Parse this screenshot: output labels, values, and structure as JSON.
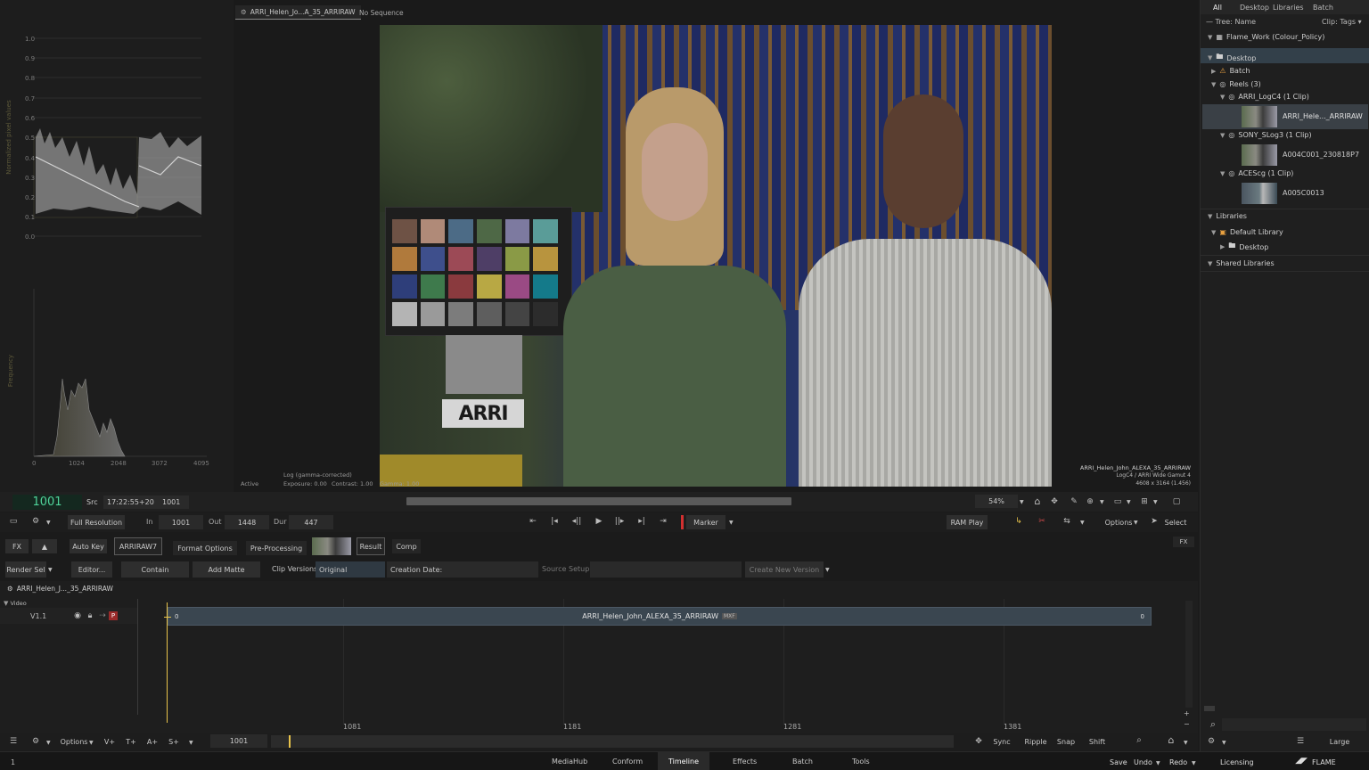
{
  "scopes": {
    "waveform_ylabel": "Normalized pixel values",
    "waveform_ticks": [
      "1.0",
      "0.9",
      "0.8",
      "0.7",
      "0.6",
      "0.5",
      "0.4",
      "0.3",
      "0.2",
      "0.1",
      "0.0"
    ],
    "hist_ylabel": "Frequency",
    "hist_ticks": [
      "0",
      "1024",
      "2048",
      "3072",
      "4095"
    ]
  },
  "viewer": {
    "clip_tab": "ARRI_Helen_Jo...A_35_ARRIRAW",
    "sequence_tab": "No Sequence",
    "status_active": "Active",
    "status_log": "Log (gamma-corrected)",
    "exposure": "Exposure: 0.00",
    "contrast": "Contrast: 1.00",
    "gamma": "Gamma: 1.00",
    "overlay_name": "ARRI_Helen_John_ALEXA_35_ARRIRAW",
    "overlay_cs": "LogC4 / ARRI Wide Gamut 4",
    "overlay_res": "4608 x 3164 (1.456)"
  },
  "transport": {
    "frame": "1001",
    "src_label": "Src",
    "timecode": "17:22:55+20",
    "frame2": "1001",
    "zoom": "54%",
    "resolution": "Full Resolution",
    "in_label": "In",
    "in_val": "1001",
    "out_label": "Out",
    "out_val": "1448",
    "dur_label": "Dur",
    "dur_val": "447",
    "marker": "Marker",
    "ram_play": "RAM Play",
    "options": "Options",
    "select": "Select"
  },
  "tools": {
    "fx": "FX",
    "auto_key": "Auto Key",
    "arriraw": "ARRIRAW7",
    "format_options": "Format Options",
    "pre_processing": "Pre-Processing",
    "result": "Result",
    "comp": "Comp",
    "fx_right": "FX",
    "render_sel": "Render Sel",
    "editor": "Editor...",
    "contain": "Contain",
    "add_matte": "Add Matte",
    "clip_versions": "Clip Versions",
    "original": "Original",
    "creation_date": "Creation Date:",
    "source_setup": "Source Setup",
    "create_new_version": "Create New Version"
  },
  "timeline": {
    "clip_title": "ARRI_Helen_J..._35_ARRIRAW",
    "video_label": "Video",
    "track": "V1.1",
    "p_badge": "P",
    "segment_name": "ARRI_Helen_John_ALEXA_35_ARRIRAW",
    "segment_badge": "MXF",
    "seg_left": "0",
    "seg_right": "0",
    "ruler": [
      "1081",
      "1181",
      "1281",
      "1381"
    ],
    "current_frame": "1001"
  },
  "bottom_toolbar": {
    "options": "Options",
    "v_plus": "V+",
    "t_plus": "T+",
    "a_plus": "A+",
    "s_plus": "S+",
    "sync": "Sync",
    "ripple": "Ripple",
    "snap": "Snap",
    "shift": "Shift"
  },
  "tabs": {
    "items": [
      "MediaHub",
      "Conform",
      "Timeline",
      "Effects",
      "Batch",
      "Tools"
    ],
    "active": "Timeline",
    "save": "Save",
    "undo": "Undo",
    "redo": "Redo",
    "licensing": "Licensing",
    "flame": "FLAME",
    "frame_ind": "1"
  },
  "library": {
    "tabs": [
      "All",
      "Desktop",
      "Libraries",
      "Batch"
    ],
    "tree_label": "Tree: Name",
    "clip_label": "Clip: Tags",
    "workspace": "Flame_Work (Colour_Policy)",
    "desktop": "Desktop",
    "batch": "Batch",
    "reels": "Reels (3)",
    "reel1": "ARRI_LogC4 (1 Clip)",
    "clip1": "ARRI_Hele..._ARRIRAW",
    "reel2": "SONY_SLog3 (1 Clip)",
    "clip2": "A004C001_230818P7",
    "reel3": "ACEScg (1 Clip)",
    "clip3": "A005C0013",
    "libraries": "Libraries",
    "default_library": "Default Library",
    "lib_desktop": "Desktop",
    "shared_libraries": "Shared Libraries",
    "size": "Large"
  },
  "colors": {
    "accent": "#e8c34a",
    "bg": "#1b1b1b",
    "selected": "#3b4650",
    "segment": "#3a4650"
  }
}
